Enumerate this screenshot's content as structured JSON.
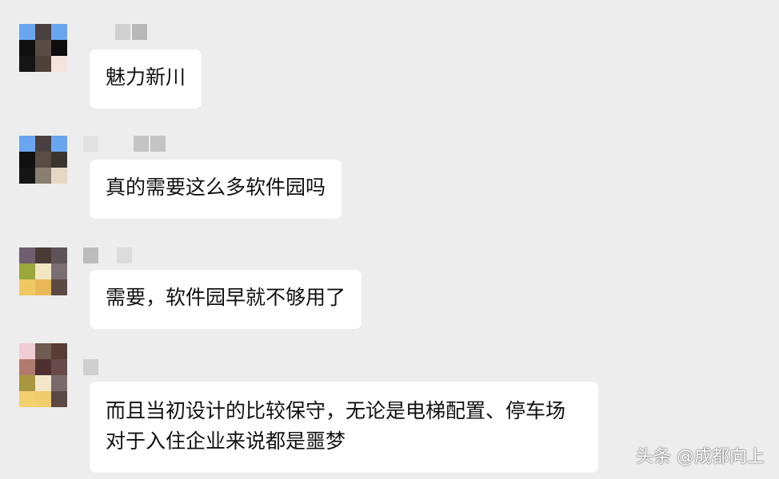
{
  "messages": [
    {
      "text": "魅力新川"
    },
    {
      "text": "真的需要这么多软件园吗"
    },
    {
      "text": "需要，软件园早就不够用了"
    },
    {
      "text": "而且当初设计的比较保守，无论是电梯配置、停车场对于入住企业来说都是噩梦"
    }
  ],
  "watermark": "头条 @成都向上",
  "colors": {
    "background": "#ededed",
    "bubble": "#ffffff",
    "text": "#111111"
  }
}
